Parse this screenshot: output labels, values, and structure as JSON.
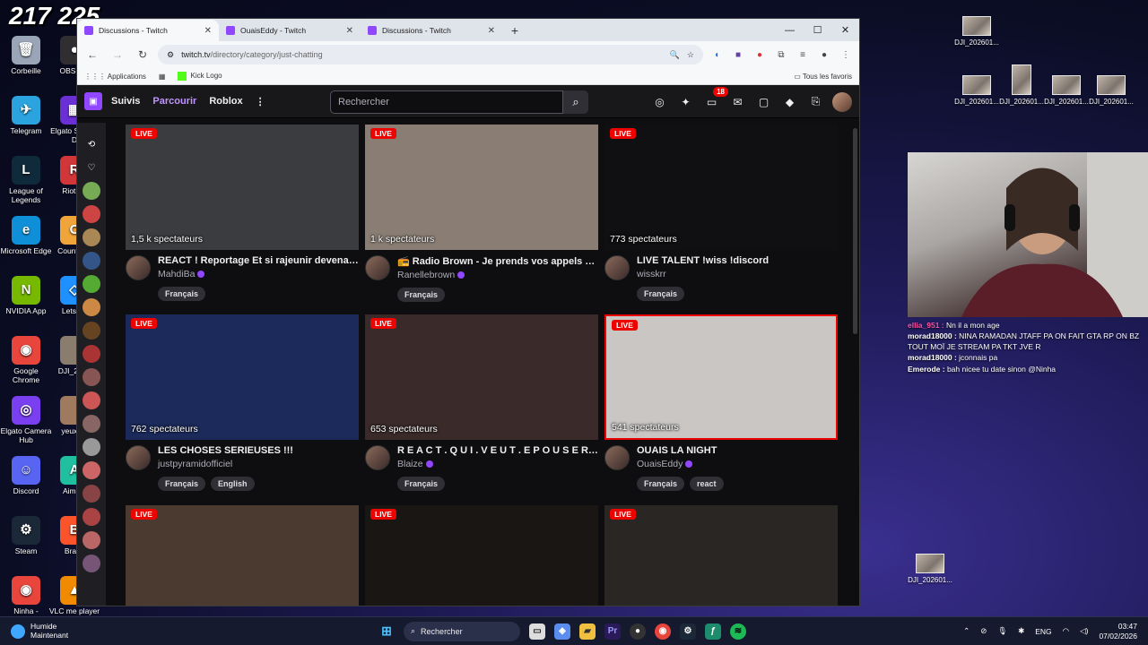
{
  "overlay": {
    "counter": "217 225"
  },
  "desktop": {
    "icons_left": [
      {
        "label": "Corbeille",
        "color": "#9aa6b8",
        "glyph": "🗑"
      },
      {
        "label": "Telegram",
        "color": "#2aa3df",
        "glyph": "✈"
      },
      {
        "label": "League of Legends",
        "color": "#0f2a3a",
        "glyph": "L"
      },
      {
        "label": "Microsoft Edge",
        "color": "#0f8fd8",
        "glyph": "e"
      },
      {
        "label": "NVIDIA App",
        "color": "#76b900",
        "glyph": "N"
      },
      {
        "label": "Google Chrome",
        "color": "#e8453c",
        "glyph": "◉"
      },
      {
        "label": "Elgato Camera Hub",
        "color": "#7b3ff2",
        "glyph": "◎"
      },
      {
        "label": "Discord",
        "color": "#5865f2",
        "glyph": "☺"
      },
      {
        "label": "Steam",
        "color": "#1b2838",
        "glyph": "⚙"
      },
      {
        "label": "Ninha - Chrome",
        "color": "#e8453c",
        "glyph": "◉"
      }
    ],
    "icons_left2": [
      {
        "label": "OBS Stu",
        "color": "#302e31",
        "glyph": "●"
      },
      {
        "label": "Elgato Stream D",
        "color": "#6b2fd6",
        "glyph": "▦"
      },
      {
        "label": "Riot Cli",
        "color": "#d13639",
        "glyph": "R"
      },
      {
        "label": "Counter-2",
        "color": "#f0a53a",
        "glyph": "C"
      },
      {
        "label": "LetsVie",
        "color": "#1e90ff",
        "glyph": "◇"
      },
      {
        "label": "DJI_2025",
        "color": "#8a7d6e",
        "glyph": ""
      },
      {
        "label": "yeux ke",
        "color": "#a07a5e",
        "glyph": ""
      },
      {
        "label": "Aimlab",
        "color": "#1fbfa0",
        "glyph": "A"
      },
      {
        "label": "Brave",
        "color": "#fb542b",
        "glyph": "B"
      },
      {
        "label": "VLC me player",
        "color": "#f08a00",
        "glyph": "▲"
      }
    ],
    "dji_files": [
      "DJI_202601...",
      "DJI_202601...",
      "DJI_202601...",
      "DJI_202601...",
      "DJI_202601...",
      "DJI_202601..."
    ]
  },
  "browser": {
    "tabs": [
      {
        "label": "Discussions - Twitch",
        "active": true
      },
      {
        "label": "OuaisEddy - Twitch",
        "active": false
      },
      {
        "label": "Discussions - Twitch",
        "active": false
      }
    ],
    "new_tab": "+",
    "url_host": "twitch.tv",
    "url_path": "/directory/category/just-chatting",
    "bookmarks": {
      "apps": "Applications",
      "kick": "Kick Logo",
      "all": "Tous les favoris"
    }
  },
  "twitch": {
    "nav": [
      "Suivis",
      "Parcourir",
      "Roblox"
    ],
    "search_placeholder": "Rechercher",
    "notif_count": "18",
    "live_label": "LIVE",
    "streams": [
      {
        "viewers": "1,5 k spectateurs",
        "title": "REACT ! Reportage Et si rajeunir devenait p...",
        "channel": "MahdiBa",
        "verified": true,
        "tags": [
          "Français"
        ],
        "thumb": "#3b3c3f"
      },
      {
        "viewers": "1 k spectateurs",
        "title": "📻 Radio Brown - Je prends vos appels 😁 ...",
        "channel": "Ranellebrown",
        "verified": true,
        "tags": [
          "Français"
        ],
        "thumb": "#8a7e74"
      },
      {
        "viewers": "773 spectateurs",
        "title": "LIVE TALENT !wiss !discord",
        "channel": "wisskrr",
        "verified": false,
        "tags": [
          "Français"
        ],
        "thumb": "#101012"
      },
      {
        "viewers": "762 spectateurs",
        "title": "LES CHOSES SERIEUSES !!!",
        "channel": "justpyramidofficiel",
        "verified": false,
        "tags": [
          "Français",
          "English"
        ],
        "thumb": "#1b2a5a"
      },
      {
        "viewers": "653 spectateurs",
        "title": "R E A C T . Q U I . V E U T . E P O U S E R . M...",
        "channel": "Blaize",
        "verified": true,
        "tags": [
          "Français"
        ],
        "thumb": "#3a2a2a"
      },
      {
        "viewers": "541 spectateurs",
        "title": "OUAIS LA NIGHT",
        "channel": "OuaisEddy",
        "verified": true,
        "tags": [
          "Français",
          "react"
        ],
        "thumb": "#c9c6c4"
      },
      {
        "viewers": "",
        "title": "",
        "channel": "",
        "verified": false,
        "tags": [],
        "thumb": "#4a3a30"
      },
      {
        "viewers": "",
        "title": "",
        "channel": "",
        "verified": false,
        "tags": [],
        "thumb": "#1a1614"
      },
      {
        "viewers": "",
        "title": "",
        "channel": "",
        "verified": false,
        "tags": [],
        "thumb": "#2a2624"
      }
    ]
  },
  "chat": [
    {
      "user": "ellia_951",
      "msg": "Nn il a mon age",
      "color": "#ff4fa8"
    },
    {
      "user": "morad18000",
      "msg": "NINA RAMADAN JTAFF PA ON FAIT GTA RP ON BZ TOUT MOÏ JE STREAM PA TKT JVE R",
      "color": "#ffffff"
    },
    {
      "user": "morad18000",
      "msg": "jconnais pa",
      "color": "#ffffff"
    },
    {
      "user": "Emerode",
      "msg": "bah nicee tu date sinon @Ninha",
      "color": "#ffffff"
    }
  ],
  "taskbar": {
    "weather_title": "Humide",
    "weather_sub": "Maintenant",
    "search": "Rechercher",
    "lang": "ENG",
    "time": "03:47",
    "date": "07/02/2026"
  }
}
